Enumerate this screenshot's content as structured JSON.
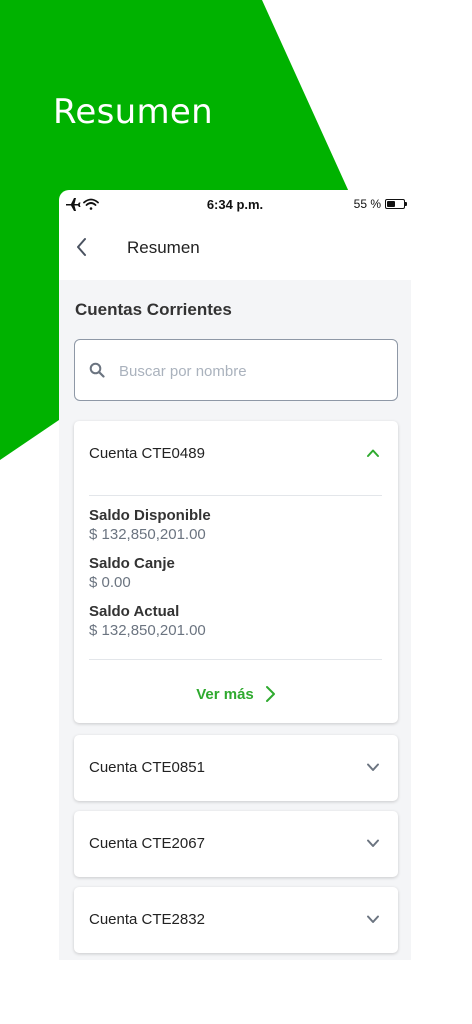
{
  "colors": {
    "brand_green": "#00b200",
    "accent_green": "#2faa2f",
    "background": "#f4f5f7"
  },
  "hero": {
    "title": "Resumen"
  },
  "status_bar": {
    "time": "6:34 p.m.",
    "battery": "55 %",
    "battery_level_percent": 55,
    "icons": [
      "airplane-icon",
      "wifi-icon"
    ]
  },
  "nav": {
    "title": "Resumen",
    "back_icon": "chevron-left-icon"
  },
  "section": {
    "title": "Cuentas Corrientes"
  },
  "search": {
    "placeholder": "Buscar por nombre",
    "value": ""
  },
  "accounts": [
    {
      "title": "Cuenta CTE0489",
      "expanded": true,
      "fields": [
        {
          "label": "Saldo Disponible",
          "value": "$ 132,850,201.00"
        },
        {
          "label": "Saldo Canje",
          "value": "$ 0.00"
        },
        {
          "label": "Saldo Actual",
          "value": "$ 132,850,201.00"
        }
      ],
      "action": "Ver más"
    },
    {
      "title": "Cuenta CTE0851",
      "expanded": false
    },
    {
      "title": "Cuenta CTE2067",
      "expanded": false
    },
    {
      "title": "Cuenta CTE2832",
      "expanded": false
    }
  ]
}
